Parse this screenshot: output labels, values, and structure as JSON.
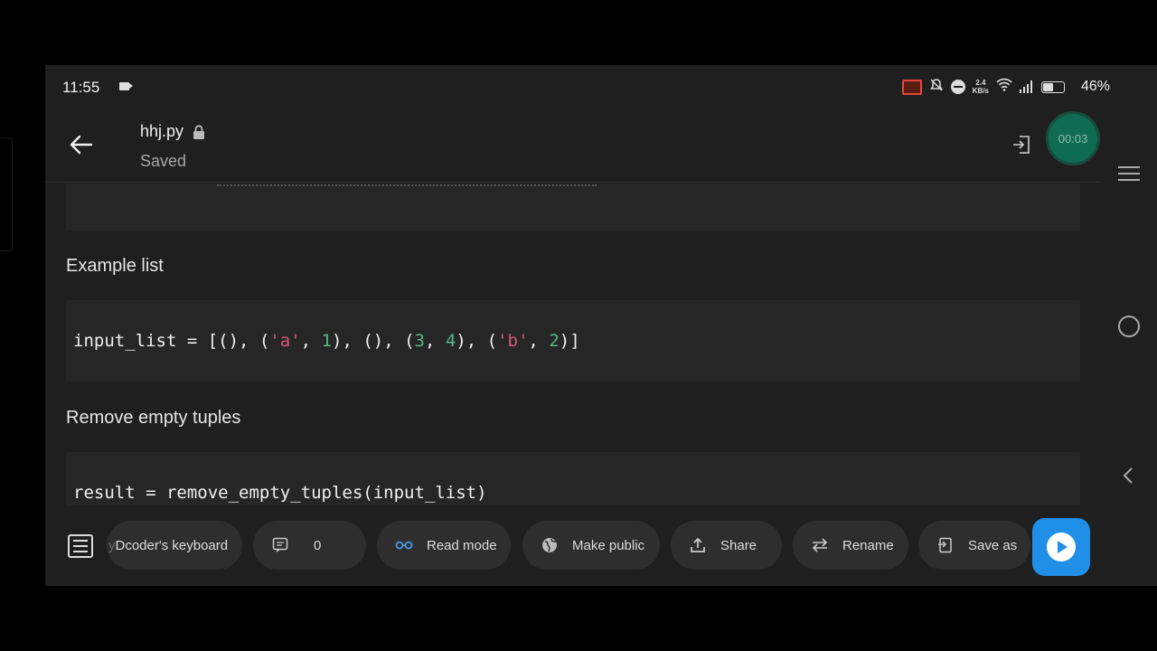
{
  "status_bar": {
    "time": "11:55",
    "net_speed_value": "2.4",
    "net_speed_unit": "KB/s",
    "battery": "46%"
  },
  "header": {
    "file_name": "hhj.py",
    "save_status": "Saved"
  },
  "recorder": {
    "timer": "00:03"
  },
  "content": {
    "heading_example": "Example list",
    "code_example": {
      "var": "input_list",
      "op": " = [(), (",
      "s1": "'a'",
      "c1": ", ",
      "n1": "1",
      "p1": "), (), (",
      "n2": "3",
      "c2": ", ",
      "n3": "4",
      "p2": "), (",
      "s2": "'b'",
      "c3": ", ",
      "n4": "2",
      "p3": ")]"
    },
    "heading_remove": "Remove empty tuples",
    "code_remove": "result = remove_empty_tuples(input_list)"
  },
  "toolbar": {
    "keyboard_prefix": "y ",
    "keyboard_label": "Dcoder's keyboard",
    "comments_count": "0",
    "read_mode_label": "Read mode",
    "make_public_label": "Make public",
    "share_label": "Share",
    "rename_label": "Rename",
    "save_as_label": "Save as"
  },
  "colors": {
    "accent_run": "#1f8fe8",
    "code_string": "#d9577a",
    "code_number": "#52b884",
    "recorder": "#0f6b51"
  }
}
